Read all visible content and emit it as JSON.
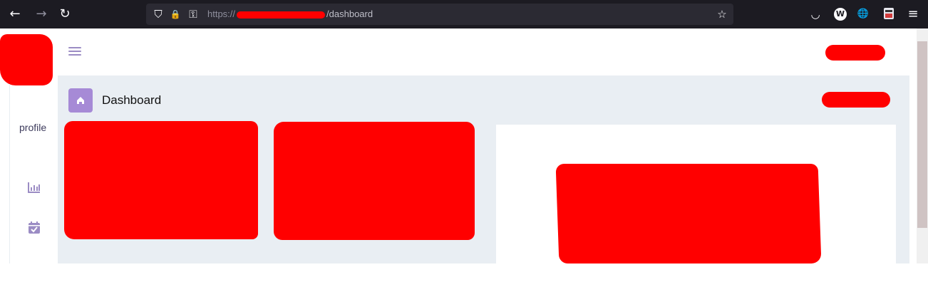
{
  "browser": {
    "back_icon": "←",
    "forward_icon": "→",
    "reload_icon": "↻",
    "url_scheme": "https://",
    "url_path": "/dashboard",
    "shield_icon": "⛉",
    "lock_icon": "🔒",
    "key_icon": "⚿",
    "bookmark_icon": "☆",
    "pocket_icon": "◡",
    "w_badge": "W",
    "globe_icon": "🌐",
    "menu_icon": "≡"
  },
  "sidebar": {
    "profile_label": "profile"
  },
  "page": {
    "title": "Dashboard"
  },
  "colors": {
    "accent": "#9b8cc4",
    "redaction": "#ff0000",
    "content_bg": "#e9eef3"
  }
}
